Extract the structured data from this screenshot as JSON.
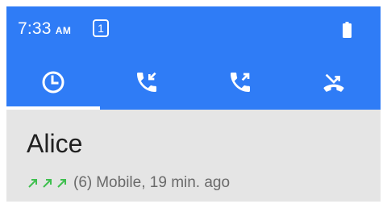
{
  "status_bar": {
    "time": "7:33",
    "ampm": "AM",
    "notification_count": "1",
    "icons": [
      "battery-icon"
    ]
  },
  "tabs": [
    {
      "icon": "clock-icon",
      "active": true
    },
    {
      "icon": "incoming-call-icon",
      "active": false
    },
    {
      "icon": "outgoing-call-icon",
      "active": false
    },
    {
      "icon": "missed-call-icon",
      "active": false
    }
  ],
  "call_log": [
    {
      "name": "Alice",
      "direction_icons": [
        "outgoing-arrow-icon",
        "outgoing-arrow-icon",
        "outgoing-arrow-icon"
      ],
      "count": "(6)",
      "type": "Mobile",
      "time_ago": ", 19 min. ago"
    }
  ],
  "colors": {
    "accent": "#2f7cf6",
    "list_background": "#e5e5e5",
    "outgoing_arrow": "#3fbf4f"
  }
}
